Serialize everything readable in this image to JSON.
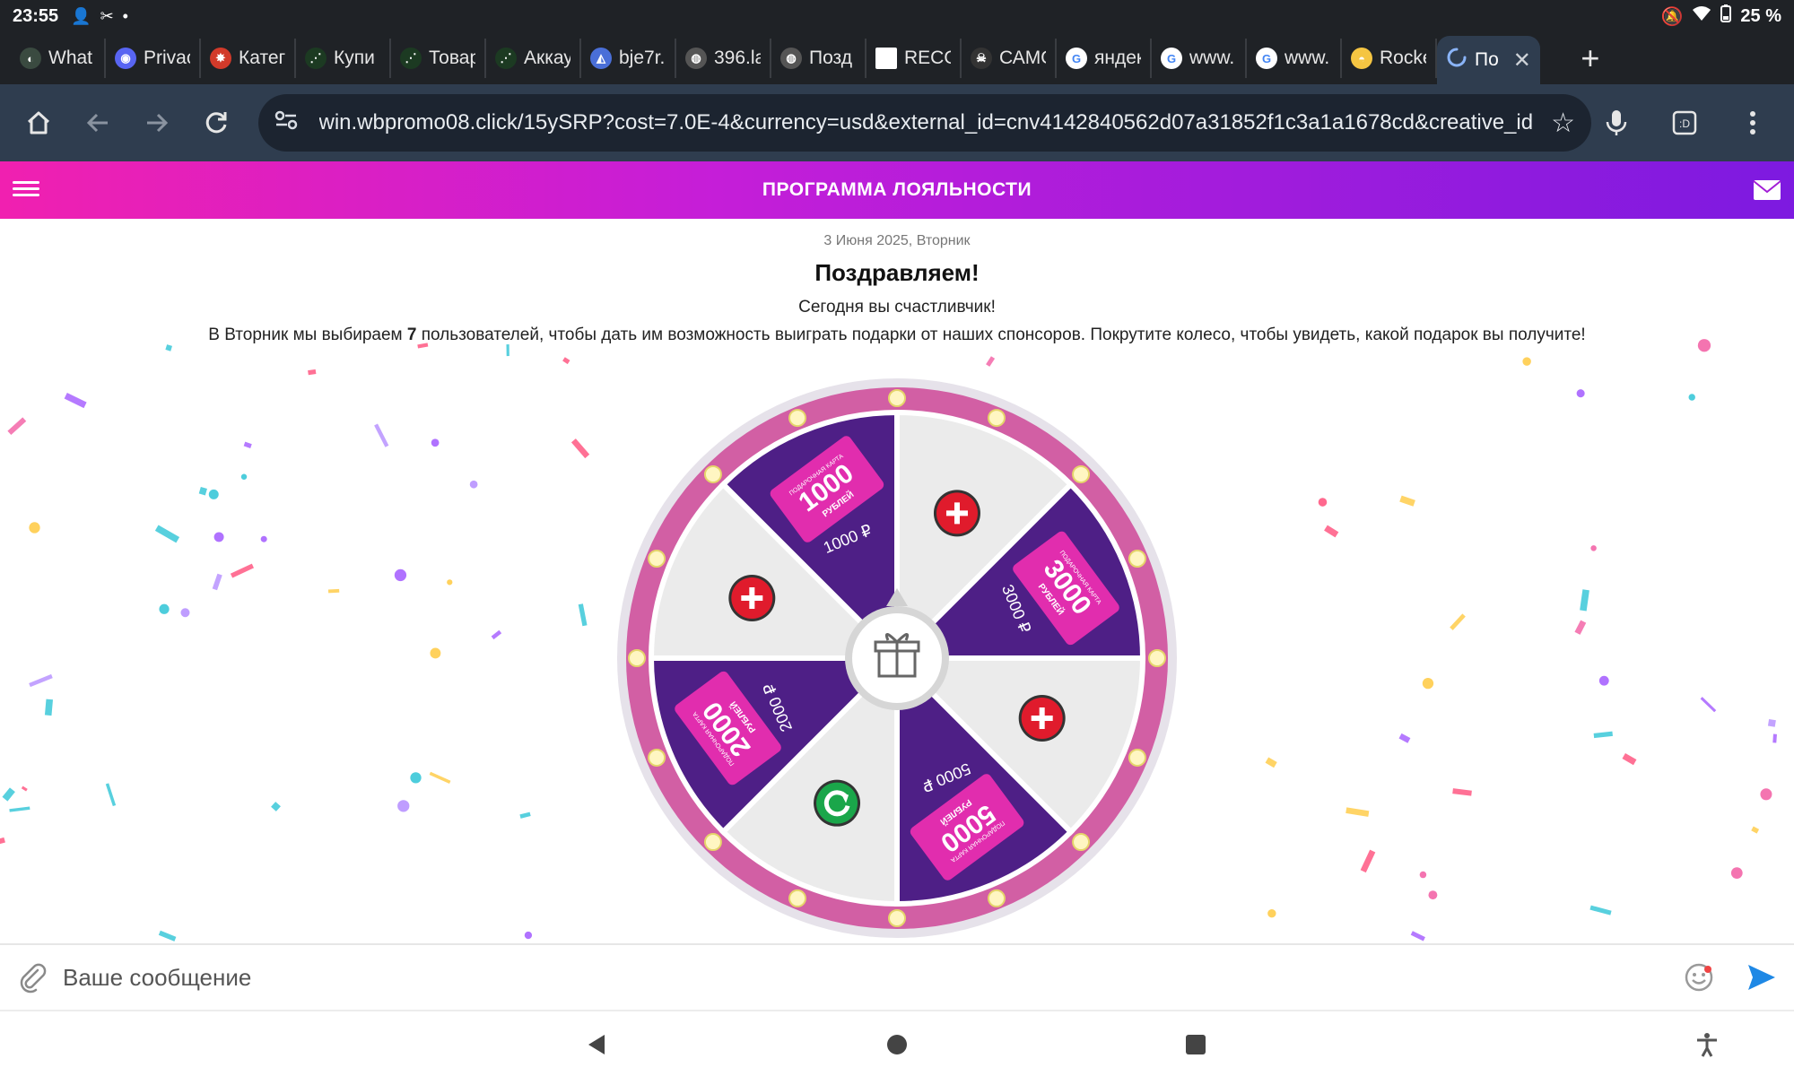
{
  "status": {
    "time": "23:55",
    "battery": "25 %"
  },
  "tabs": [
    {
      "label": "What",
      "fav": "◐",
      "color": "#3a4a40"
    },
    {
      "label": "Privac",
      "fav": "◉",
      "color": "#5865f2"
    },
    {
      "label": "Катег",
      "fav": "✸",
      "color": "#d23a2a"
    },
    {
      "label": "Купи",
      "fav": "⋰",
      "color": "#1c3a22"
    },
    {
      "label": "Товар",
      "fav": "⋰",
      "color": "#1c3a22"
    },
    {
      "label": "Аккау",
      "fav": "⋰",
      "color": "#1c3a22"
    },
    {
      "label": "bje7r.",
      "fav": "◭",
      "color": "#4a6fd8"
    },
    {
      "label": "396.la",
      "fav": "◍",
      "color": "#555"
    },
    {
      "label": "Позд",
      "fav": "◍",
      "color": "#555"
    },
    {
      "label": "RECO",
      "fav": "",
      "color": "#ffffff"
    },
    {
      "label": "САМО",
      "fav": "☠",
      "color": "#333"
    },
    {
      "label": "яндек",
      "fav": "G",
      "color": "#ffffff"
    },
    {
      "label": "www.",
      "fav": "G",
      "color": "#ffffff"
    },
    {
      "label": "www.",
      "fav": "G",
      "color": "#ffffff"
    },
    {
      "label": "Rocke",
      "fav": "◓",
      "color": "#f5c542"
    }
  ],
  "active_tab": {
    "label": "По"
  },
  "omnibox": {
    "url": "win.wbpromo08.click/15ySRP?cost=7.0E-4&currency=usd&external_id=cnv4142840562d07a31852f1c3a1a1678cd&creative_id"
  },
  "page": {
    "header_title": "ПРОГРАММА ЛОЯЛЬНОСТИ",
    "date": "3 Июня 2025, Вторник",
    "congrats": "Поздравляем!",
    "lucky": "Сегодня вы счастливчик!",
    "info_before": "В Вторник мы выбираем ",
    "info_count": "7",
    "info_after": " пользователей, чтобы дать им возможность выиграть подарки от наших спонсоров. Покрутите колесо, чтобы увидеть, какой подарок вы получите!"
  },
  "wheel": {
    "card_caption": "ПОДАРОЧНАЯ КАРТА",
    "card_unit": "РУБЛЕЙ",
    "prizes": [
      {
        "amount": "1000",
        "label": "1000 ₽"
      },
      {
        "amount": "3000",
        "label": "3000 ₽"
      },
      {
        "amount": "5000",
        "label": "5000 ₽"
      },
      {
        "amount": "2000",
        "label": "2000 ₽"
      }
    ],
    "colors": {
      "rim": "#d25fa4",
      "purple": "#4e1f86",
      "gray": "#ebebeb",
      "card": "#e12dae"
    }
  },
  "message": {
    "placeholder": "Ваше сообщение"
  }
}
